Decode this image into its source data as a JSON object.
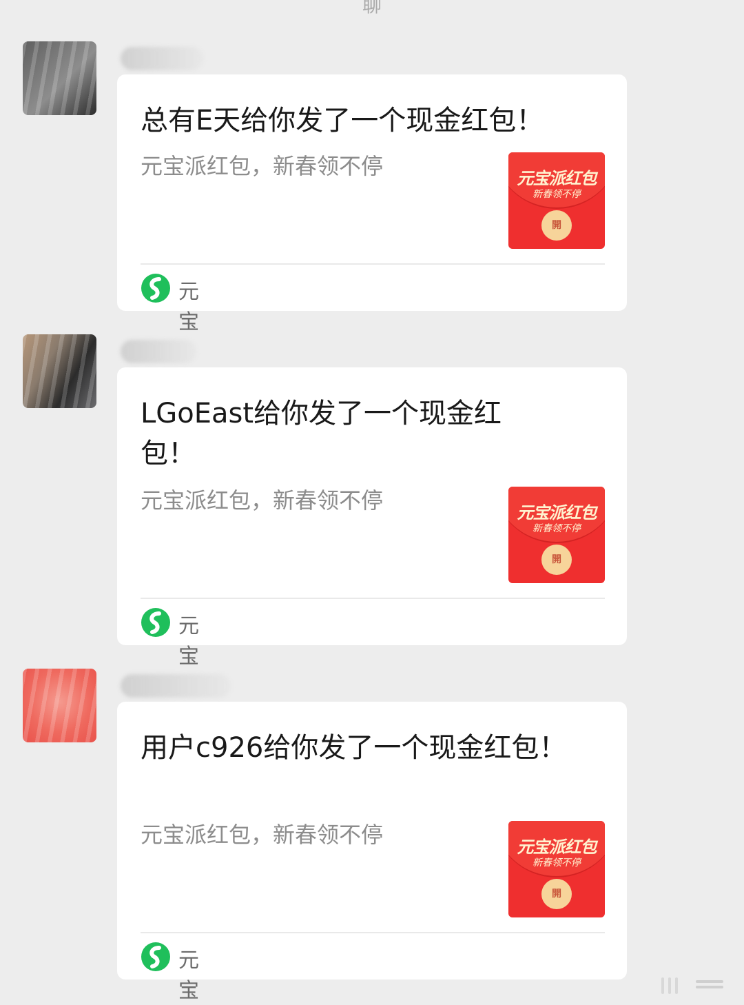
{
  "header": {
    "partial_label": "聊"
  },
  "messages": [
    {
      "title": "总有E天给你发了一个现金红包！",
      "desc": "元宝派红包，新春领不停",
      "envelope_title": "元宝派红包",
      "envelope_sub": "新春领不停",
      "open_label": "開",
      "app_name": "元宝"
    },
    {
      "title": "LGoEast给你发了一个现金红包！",
      "desc": "元宝派红包，新春领不停",
      "envelope_title": "元宝派红包",
      "envelope_sub": "新春领不停",
      "open_label": "開",
      "app_name": "元宝"
    },
    {
      "title": "用户c926给你发了一个现金红包！",
      "desc": "元宝派红包，新春领不停",
      "envelope_title": "元宝派红包",
      "envelope_sub": "新春领不停",
      "open_label": "開",
      "app_name": "元宝"
    }
  ],
  "colors": {
    "background": "#ededed",
    "card": "#ffffff",
    "envelope_red": "#ef2f2f",
    "app_icon_green": "#1fbf5b"
  },
  "icons": {
    "app": "yuanbao-logo-icon",
    "envelope": "red-packet-icon"
  }
}
